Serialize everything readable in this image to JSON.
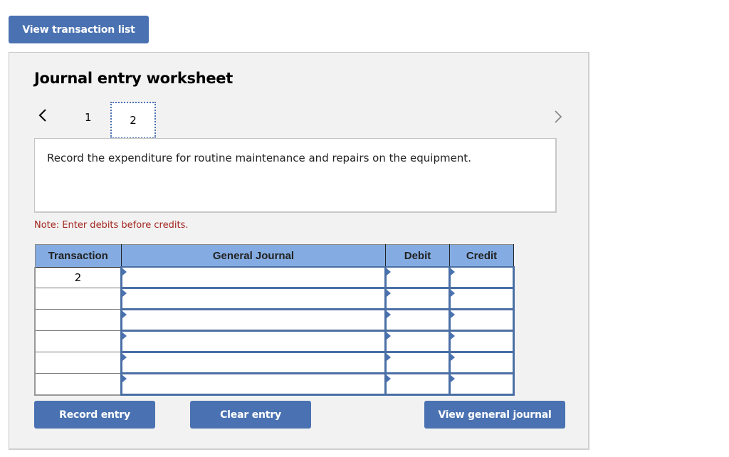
{
  "top_button": {
    "label": "View transaction list"
  },
  "worksheet": {
    "title": "Journal entry worksheet",
    "nav": {
      "prev_icon": "chevron-left-icon",
      "next_icon": "chevron-right-icon",
      "pages": [
        "1",
        "2"
      ],
      "current_page": "2"
    },
    "description": "Record the expenditure for routine maintenance and repairs on the equipment.",
    "note": "Note: Enter debits before credits.",
    "table": {
      "headers": [
        "Transaction",
        "General Journal",
        "Debit",
        "Credit"
      ],
      "rows": [
        {
          "transaction": "2",
          "account": "",
          "debit": "",
          "credit": ""
        },
        {
          "transaction": "",
          "account": "",
          "debit": "",
          "credit": ""
        },
        {
          "transaction": "",
          "account": "",
          "debit": "",
          "credit": ""
        },
        {
          "transaction": "",
          "account": "",
          "debit": "",
          "credit": ""
        },
        {
          "transaction": "",
          "account": "",
          "debit": "",
          "credit": ""
        },
        {
          "transaction": "",
          "account": "",
          "debit": "",
          "credit": ""
        }
      ]
    },
    "buttons": {
      "record": "Record entry",
      "clear": "Clear entry",
      "view_gj": "View general journal"
    }
  },
  "colors": {
    "button_bg": "#4a72b2",
    "header_bg": "#84ace2",
    "note_text": "#a3261f",
    "panel_bg": "#f2f2f2"
  }
}
